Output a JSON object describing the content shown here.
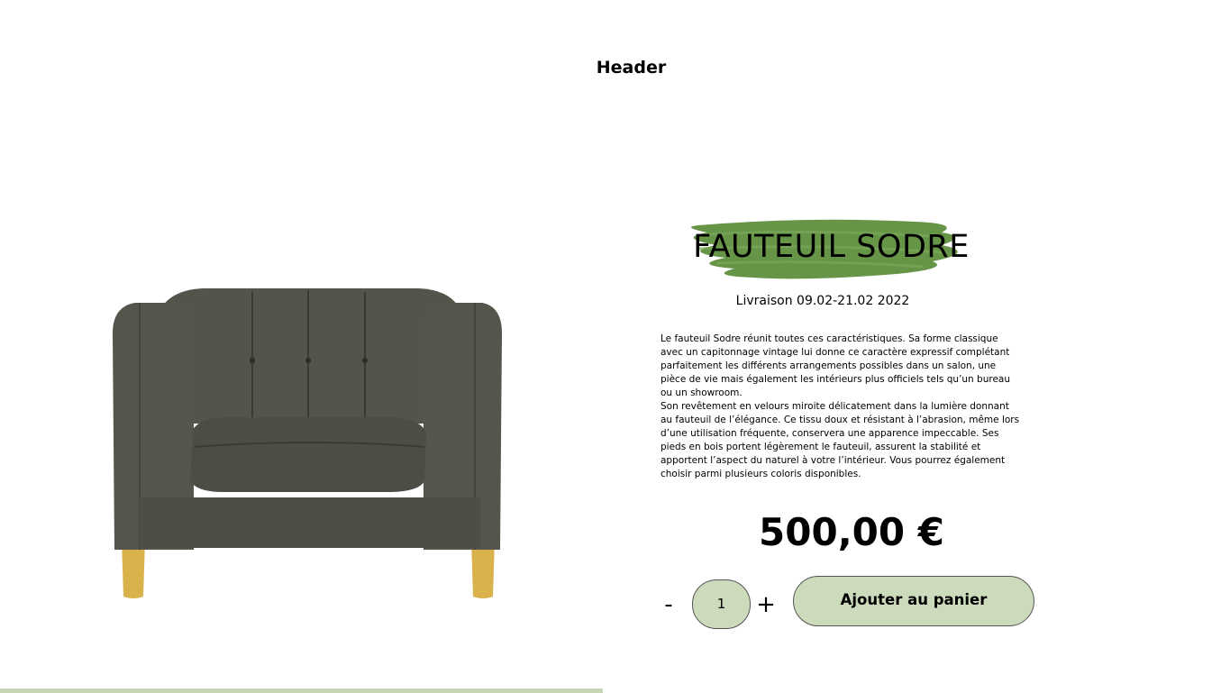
{
  "header": {
    "title": "Header"
  },
  "product": {
    "title": "FAUTEUIL SODRE",
    "delivery": "Livraison 09.02-21.02 2022",
    "description": " Le fauteuil Sodre réunit toutes ces caractéristiques. Sa forme classique avec un capitonnage vintage lui donne ce caractère expressif complétant parfaitement les différents arrangements possibles dans un salon, une pièce de vie mais également les intérieurs plus officiels tels qu’un bureau ou un showroom.\nSon revêtement en velours miroite délicatement dans la lumière donnant au fauteuil de l’élégance. Ce tissu doux et résistant à l’abrasion, même lors d’une utilisation fréquente, conservera une apparence impeccable. Ses pieds en bois portent légèrement le fauteuil, assurent la stabilité et apportent l’aspect du naturel à votre l’intérieur. Vous pourrez également choisir parmi plusieurs coloris disponibles.",
    "price": "500,00 €"
  },
  "cart": {
    "minus_label": "-",
    "plus_label": "+",
    "quantity": "1",
    "add_label": "Ajouter au panier"
  },
  "colors": {
    "accent_green": "#cddbbd",
    "brush_green": "#5f8f3e",
    "bottom_bar": "#c7d5b4",
    "sofa_fabric": "#4a4a42",
    "sofa_legs": "#d8b24a"
  },
  "icons": {
    "product_image": "armchair-image",
    "title_brush": "green-brush-stroke"
  }
}
